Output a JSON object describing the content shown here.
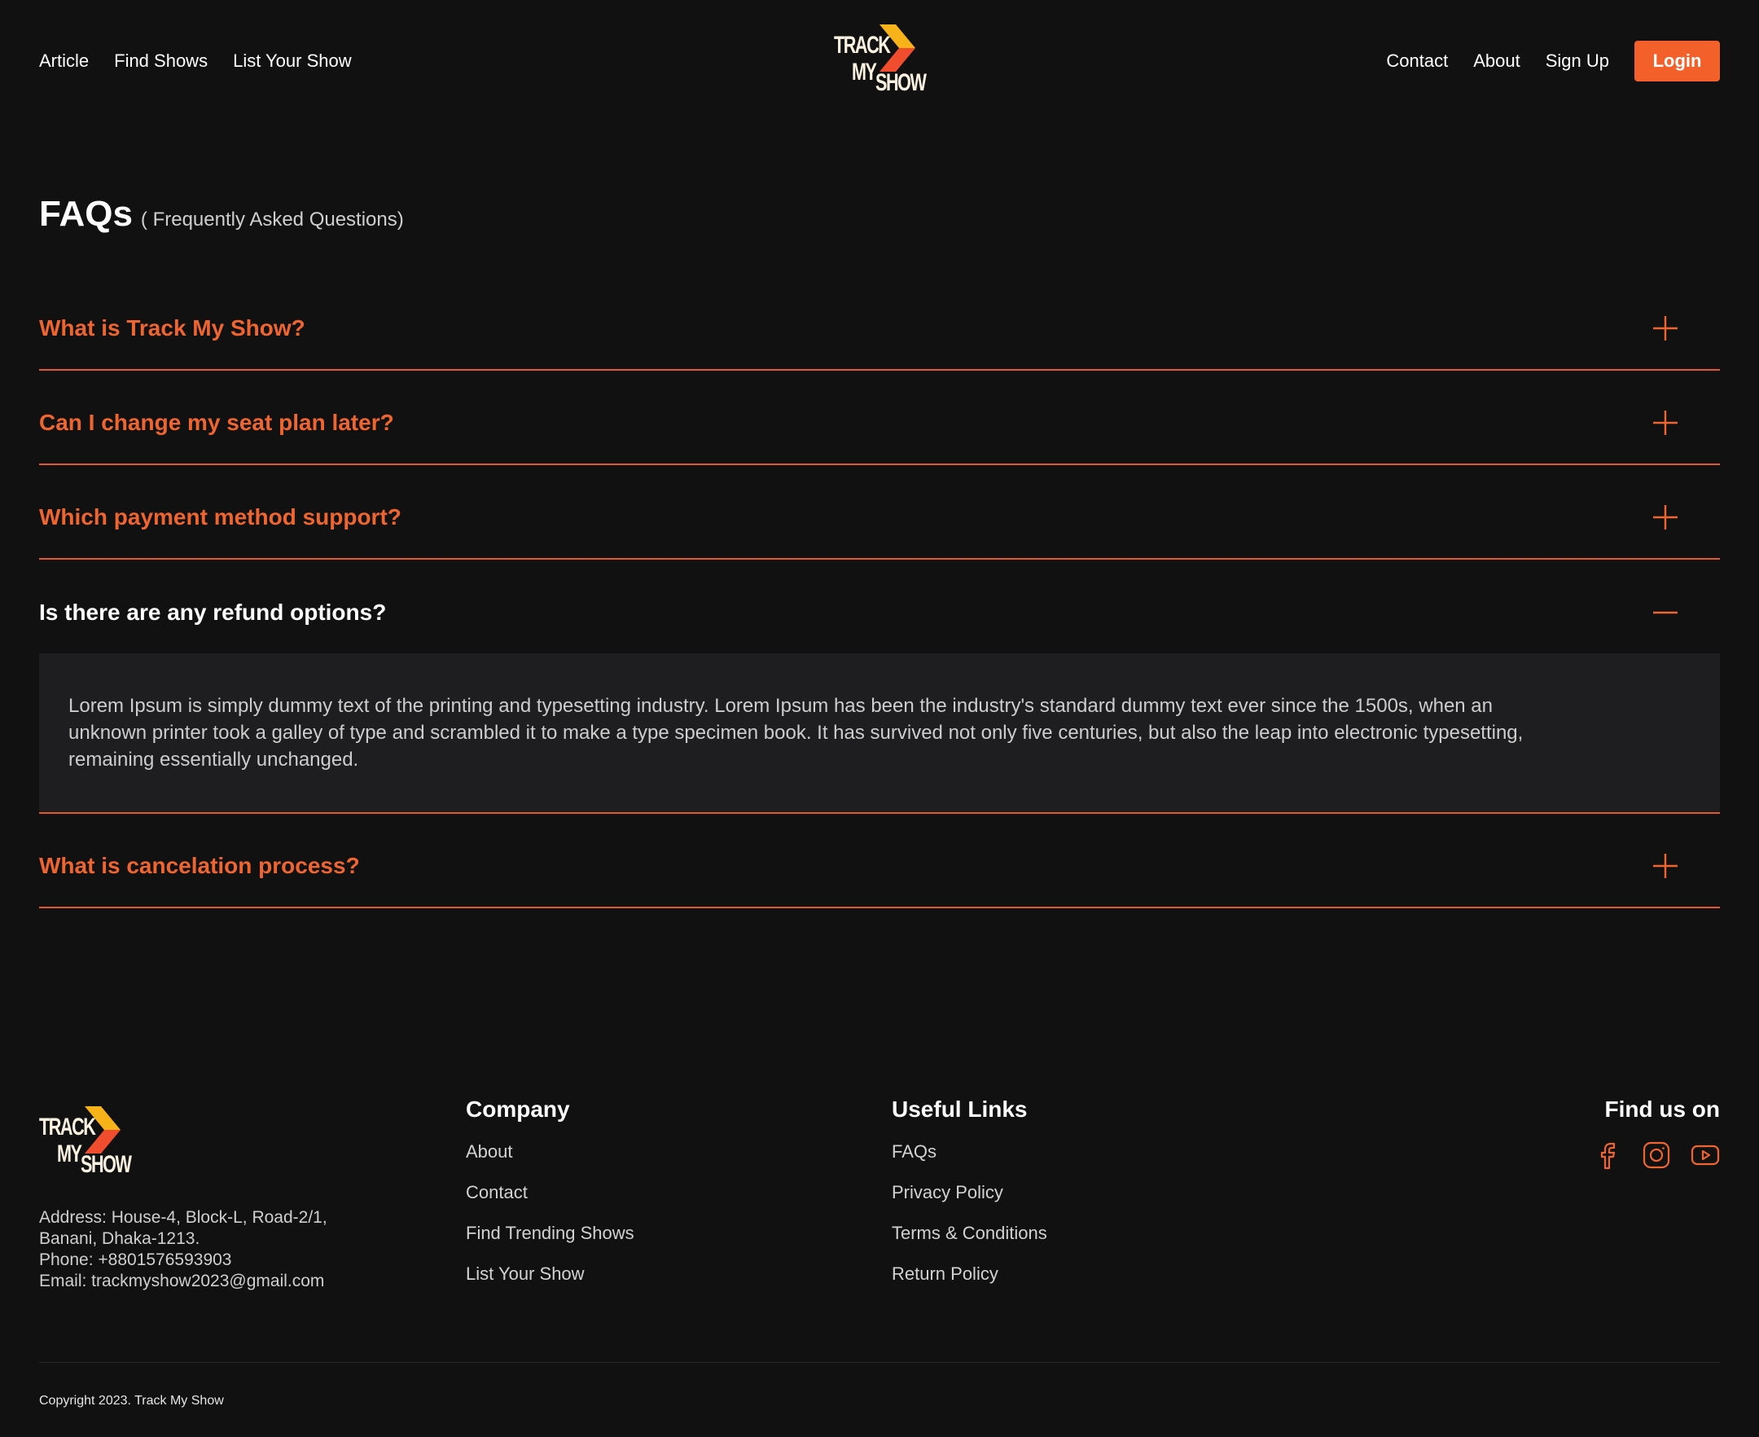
{
  "brand": {
    "logo_line1": "TRACK",
    "logo_line2": "MY",
    "logo_line3": "SHOW",
    "accent_color": "#f4602a",
    "chevron_color_top": "#f8b319",
    "chevron_color_bottom": "#ef4d2e"
  },
  "header": {
    "nav_left": [
      "Article",
      "Find Shows",
      "List Your Show"
    ],
    "nav_right": [
      "Contact",
      "About",
      "Sign Up"
    ],
    "login_label": "Login"
  },
  "faq": {
    "title": "FAQs",
    "subtitle": "( Frequently Asked Questions)",
    "items": [
      {
        "question": "What is Track My Show?",
        "open": false,
        "icon": "plus-icon"
      },
      {
        "question": "Can I change my seat plan later?",
        "open": false,
        "icon": "plus-icon"
      },
      {
        "question": "Which payment method support?",
        "open": false,
        "icon": "plus-icon"
      },
      {
        "question": "Is there are any refund options?",
        "open": true,
        "icon": "minus-icon",
        "answer": "Lorem Ipsum is simply dummy text of the printing and typesetting industry. Lorem Ipsum has been the industry's standard dummy text ever since the 1500s, when an unknown printer took a galley of type and scrambled it to make a type specimen book. It has survived not only five centuries, but also the leap into electronic typesetting, remaining essentially unchanged."
      },
      {
        "question": "What is cancelation process?",
        "open": false,
        "icon": "plus-icon"
      }
    ]
  },
  "footer": {
    "address_line1": "Address: House-4, Block-L, Road-2/1,",
    "address_line2": "Banani, Dhaka-1213.",
    "phone": "Phone:  +8801576593903",
    "email": "Email:  trackmyshow2023@gmail.com",
    "company": {
      "title": "Company",
      "links": [
        "About",
        "Contact",
        "Find Trending Shows",
        "List Your Show"
      ]
    },
    "useful_links": {
      "title": "Useful Links",
      "links": [
        "FAQs",
        "Privacy Policy",
        "Terms & Conditions",
        "Return Policy"
      ]
    },
    "find_us": {
      "title": "Find us on",
      "icons": [
        "facebook-icon",
        "instagram-icon",
        "youtube-icon"
      ]
    },
    "copyright": "Copyright 2023. Track My Show"
  }
}
